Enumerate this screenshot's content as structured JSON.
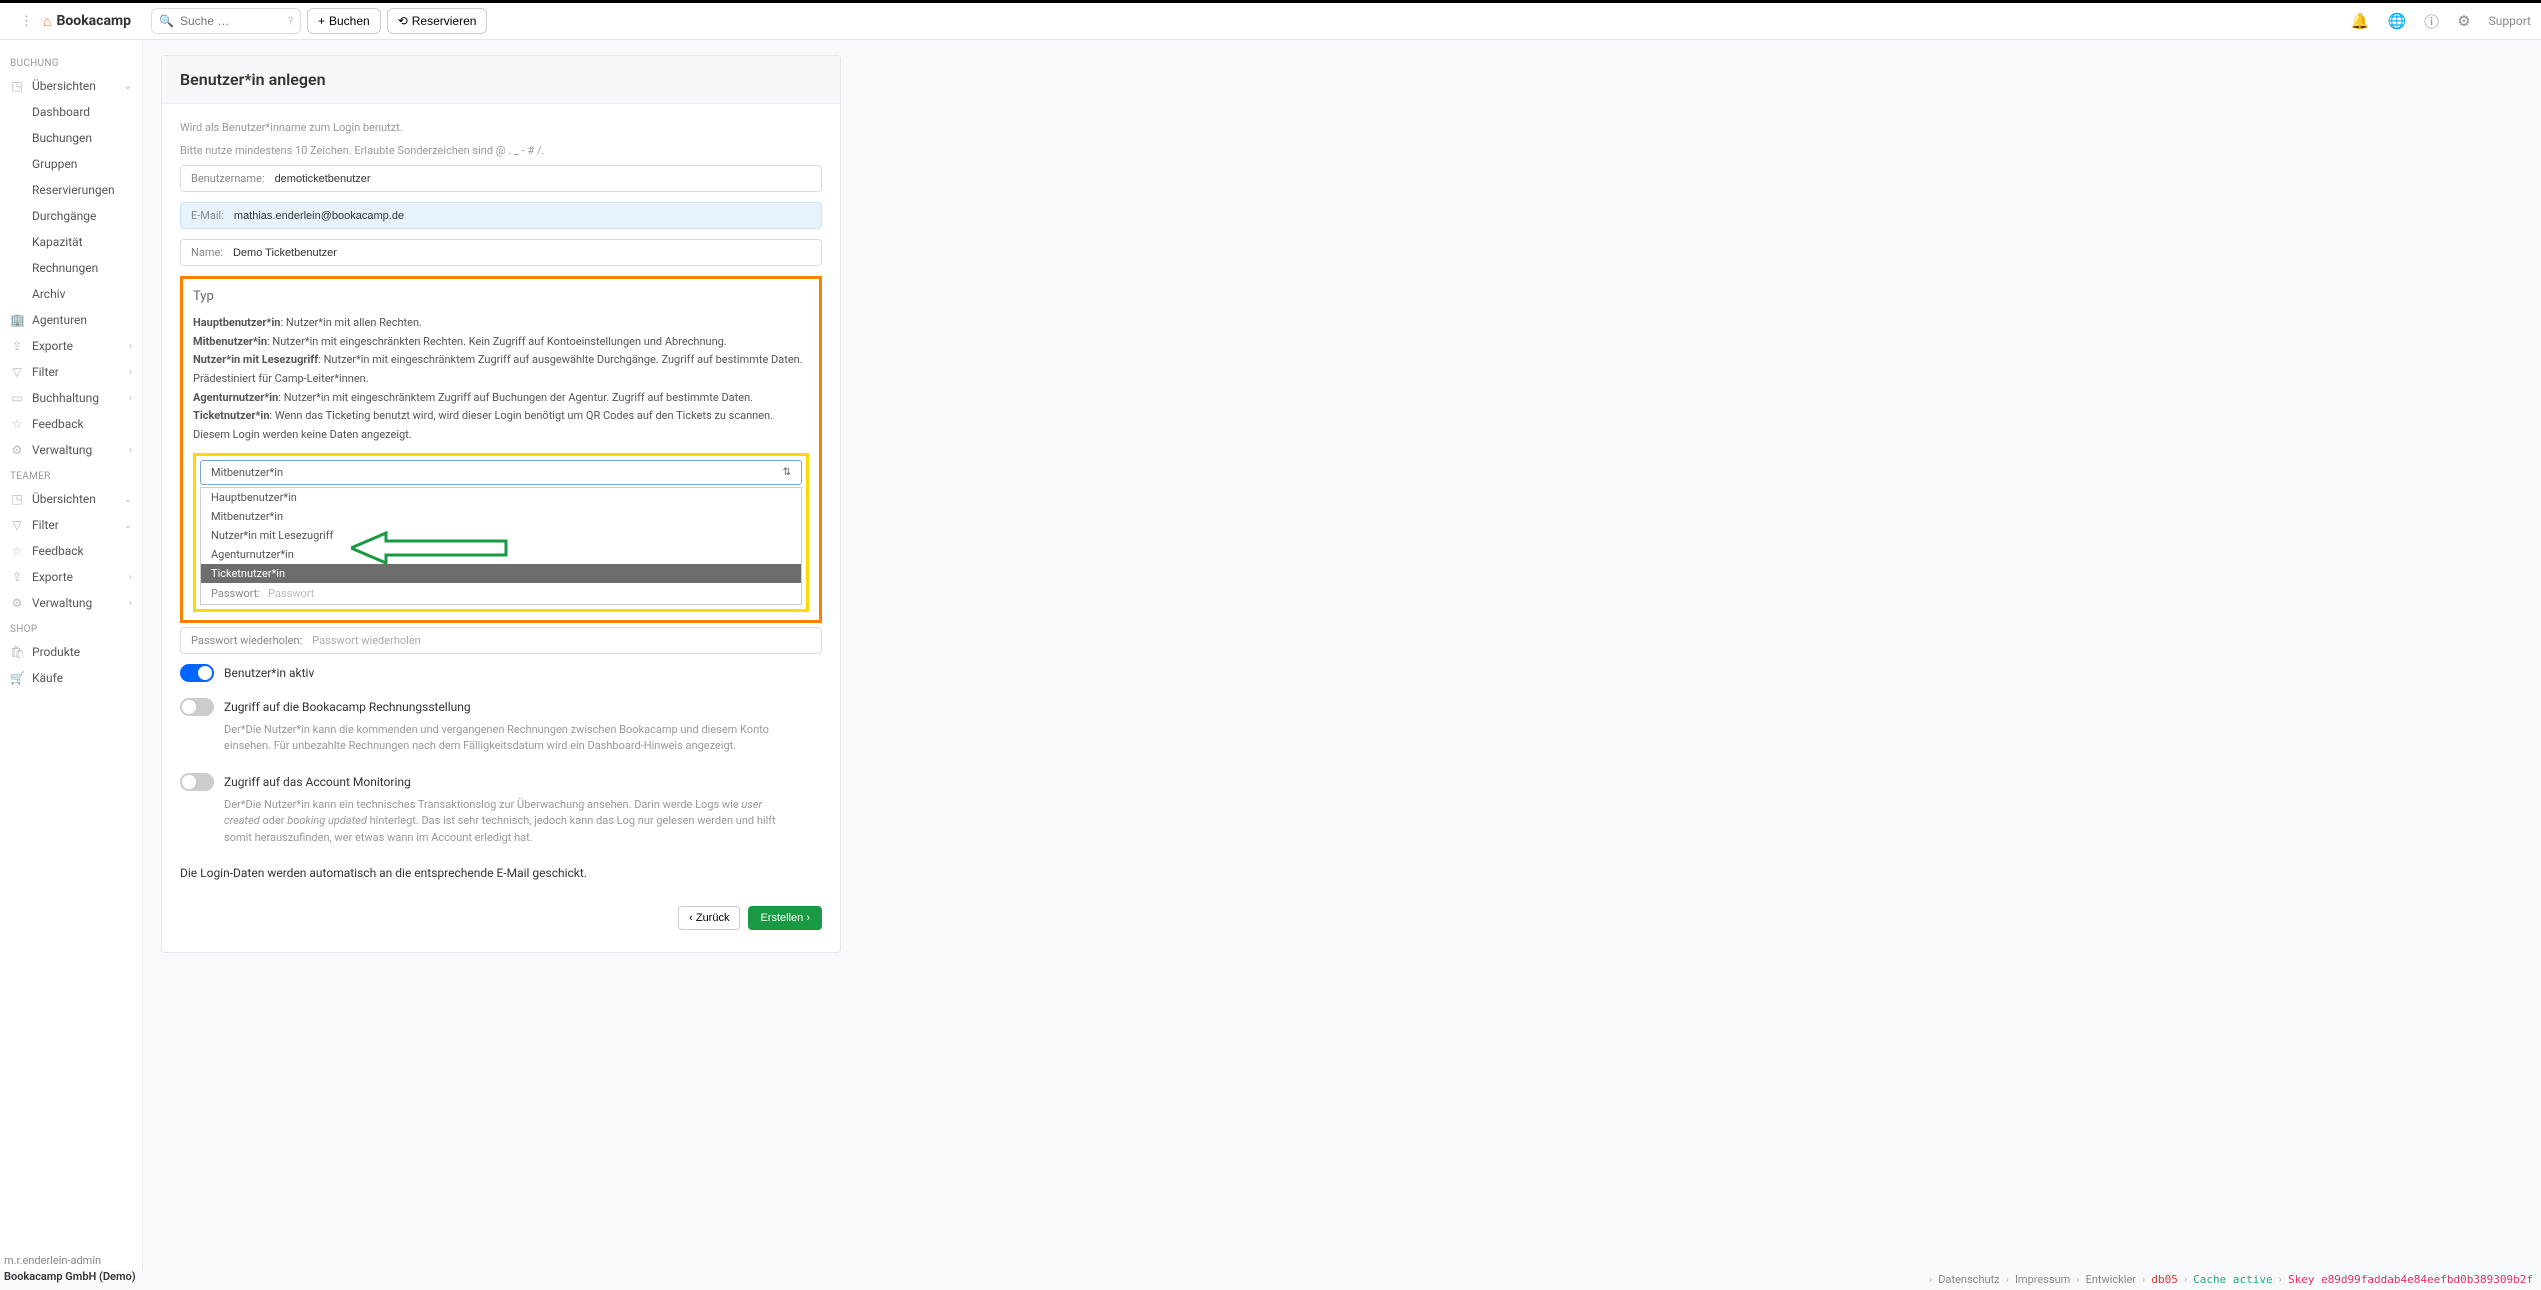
{
  "app": {
    "name": "Bookacamp"
  },
  "topbar": {
    "search_placeholder": "Suche …",
    "buchen": "Buchen",
    "reservieren": "Reservieren",
    "support": "Support"
  },
  "sidebar": {
    "sec_buchung": "BUCHUNG",
    "uebersichten": "Übersichten",
    "sub": {
      "dashboard": "Dashboard",
      "buchungen": "Buchungen",
      "gruppen": "Gruppen",
      "reservierungen": "Reservierungen",
      "durchgaenge": "Durchgänge",
      "kapazitaet": "Kapazität",
      "rechnungen": "Rechnungen",
      "archiv": "Archiv"
    },
    "agenturen": "Agenturen",
    "exporte": "Exporte",
    "filter": "Filter",
    "buchhaltung": "Buchhaltung",
    "feedback": "Feedback",
    "verwaltung": "Verwaltung",
    "sec_teamer": "TEAMER",
    "t_uebersichten": "Übersichten",
    "t_filter": "Filter",
    "t_feedback": "Feedback",
    "t_exporte": "Exporte",
    "t_verwaltung": "Verwaltung",
    "sec_shop": "SHOP",
    "produkte": "Produkte",
    "kaeufe": "Käufe",
    "user": "m.r.enderlein-admin",
    "tenant": "Bookacamp GmbH (Demo)"
  },
  "form": {
    "title": "Benutzer*in anlegen",
    "help1": "Wird als Benutzer*inname zum Login benutzt.",
    "help2": "Bitte nutze mindestens 10 Zeichen. Erlaubte Sonderzeichen sind @ . _ - # /.",
    "username_label": "Benutzername:",
    "username_value": "demoticketbenutzer",
    "email_label": "E-Mail:",
    "email_value": "mathias.enderlein@bookacamp.de",
    "name_label": "Name:",
    "name_value": "Demo Ticketbenutzer",
    "typ_heading": "Typ",
    "typ_desc": {
      "l1b": "Hauptbenutzer*in",
      "l1": ": Nutzer*in mit allen Rechten.",
      "l2b": "Mitbenutzer*in",
      "l2": ": Nutzer*in mit eingeschränkten Rechten. Kein Zugriff auf Kontoeinstellungen und Abrechnung.",
      "l3b": "Nutzer*in mit Lesezugriff",
      "l3": ": Nutzer*in mit eingeschränktem Zugriff auf ausgewählte Durchgänge. Zugriff auf bestimmte Daten. Prädestiniert für Camp-Leiter*innen.",
      "l4b": "Agenturnutzer*in",
      "l4": ": Nutzer*in mit eingeschränktem Zugriff auf Buchungen der Agentur. Zugriff auf bestimmte Daten.",
      "l5b": "Ticketnutzer*in",
      "l5": ": Wenn das Ticketing benutzt wird, wird dieser Login benötigt um QR Codes auf den Tickets zu scannen. Diesem Login werden keine Daten angezeigt."
    },
    "select_value": "Mitbenutzer*in",
    "options": {
      "o1": "Hauptbenutzer*in",
      "o2": "Mitbenutzer*in",
      "o3": "Nutzer*in mit Lesezugriff",
      "o4": "Agenturnutzer*in",
      "o5": "Ticketnutzer*in"
    },
    "pw_label": "Passwort:",
    "pw_placeholder": "Passwort",
    "pw2_label": "Passwort wiederholen:",
    "pw2_placeholder": "Passwort wiederholen",
    "toggle_active": "Benutzer*in aktiv",
    "toggle_billing": "Zugriff auf die Bookacamp Rechnungsstellung",
    "toggle_billing_help": "Der*Die Nutzer*in kann die kommenden und vergangenen Rechnungen zwischen Bookacamp und diesem Konto einsehen. Für unbezahlte Rechnungen nach dem Fälligkeitsdatum wird ein Dashboard-Hinweis angezeigt.",
    "toggle_monitoring": "Zugriff auf das Account Monitoring",
    "toggle_monitoring_help_pre": "Der*Die Nutzer*in kann ein technisches Transaktionslog zur Überwachung ansehen. Darin werde Logs wie ",
    "toggle_monitoring_help_i1": "user created",
    "toggle_monitoring_help_mid": " oder ",
    "toggle_monitoring_help_i2": "booking updated",
    "toggle_monitoring_help_post": " hinterlegt. Das ist sehr technisch, jedoch kann das Log nur gelesen werden und hilft somit herauszufinden, wer etwas wann im Account erledigt hat.",
    "login_info": "Die Login-Daten werden automatisch an die entsprechende E-Mail geschickt.",
    "back": "Zurück",
    "create": "Erstellen"
  },
  "footer": {
    "datenschutz": "Datenschutz",
    "impressum": "Impressum",
    "entwickler": "Entwickler",
    "db": "db05",
    "cache": "Cache active",
    "key": "Skey e89d99faddab4e84eefbd0b389309b2f"
  }
}
